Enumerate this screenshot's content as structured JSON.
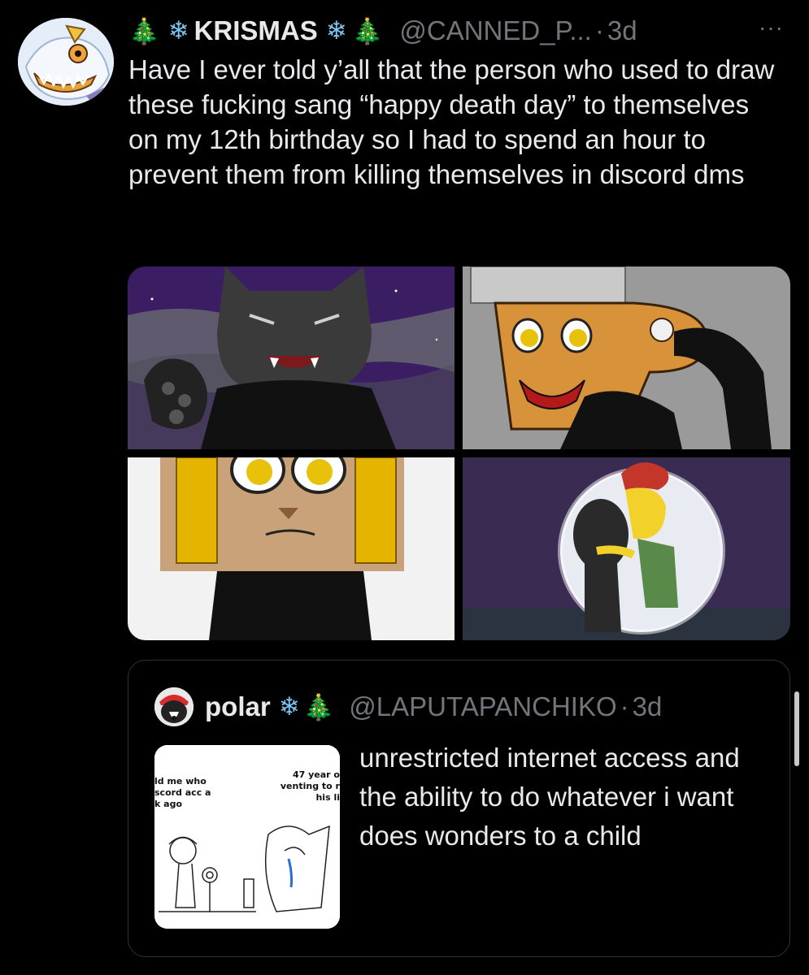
{
  "tweet": {
    "author": {
      "display_name": "KRISMAS",
      "name_emoji_left": [
        "🎄",
        "❄"
      ],
      "name_emoji_right": [
        "❄",
        "🎄"
      ],
      "handle": "@CANNED_P...",
      "time": "3d",
      "separator": "·"
    },
    "more_label": "···",
    "text": "Have I ever told y’all that the person who used to draw these fucking sang “happy death day” to themselves on my 12th birthday so I had to spend an hour to prevent them from killing themselves in discord dms",
    "media": [
      {
        "name": "werewolf-cat-drawing"
      },
      {
        "name": "toaster-wolf-drawing"
      },
      {
        "name": "toaster-cat-face-drawing"
      },
      {
        "name": "sideshow-bob-moon-drawing"
      }
    ]
  },
  "quote": {
    "author": {
      "display_name": "polar",
      "name_emoji": [
        "❄",
        "🎄"
      ],
      "handle": "@LAPUTAPANCHIKO",
      "separator": "·",
      "time": "3d"
    },
    "text": "unrestricted internet access and the ability to do whatever i want does wonders to a child",
    "thumbnail": {
      "caption_left": [
        "ld me who",
        "scord acc a",
        "k ago"
      ],
      "caption_right": [
        "47 year o",
        "venting to r",
        "his li"
      ]
    }
  },
  "colors": {
    "background": "#000000",
    "text": "#e7e9ea",
    "secondary": "#71767b",
    "border": "#2f3336"
  }
}
